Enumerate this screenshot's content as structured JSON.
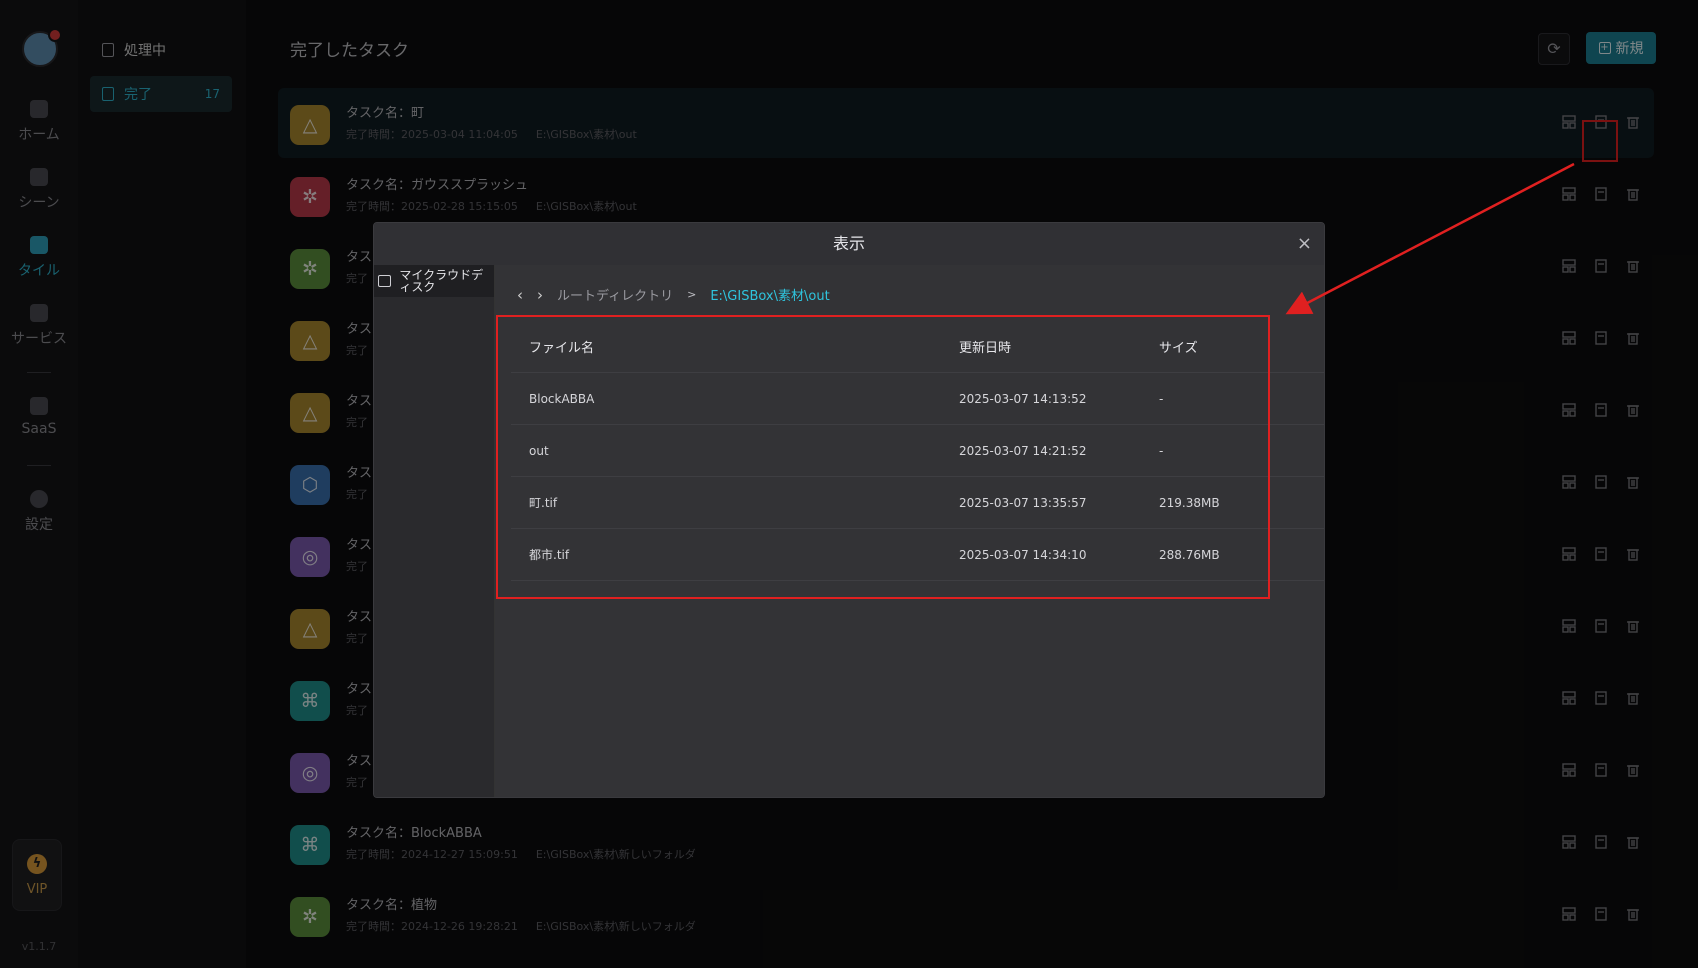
{
  "sidebar": {
    "items": [
      {
        "label": "ホーム"
      },
      {
        "label": "シーン"
      },
      {
        "label": "タイル"
      },
      {
        "label": "サービス"
      },
      {
        "label": "SaaS"
      },
      {
        "label": "設定"
      }
    ],
    "vip_label": "VIP",
    "version": "v1.1.7"
  },
  "subnav": {
    "processing_label": "処理中",
    "done_label": "完了",
    "done_count": "17"
  },
  "main": {
    "title": "完了したタスク",
    "new_label": "新規"
  },
  "tasks": [
    {
      "name": "タスク名：町",
      "time": "完了時間：2025-03-04 11:04:05",
      "path": "E:\\GISBox\\素材\\out",
      "color": "#a8872f",
      "glyph": "△"
    },
    {
      "name": "タスク名：ガウススプラッシュ",
      "time": "完了時間：2025-02-28 15:15:05",
      "path": "E:\\GISBox\\素材\\out",
      "color": "#b83a4a",
      "glyph": "✲"
    },
    {
      "name": "タス",
      "time": "完了",
      "path": "",
      "color": "#5c8f3c",
      "glyph": "✲"
    },
    {
      "name": "タス",
      "time": "完了",
      "path": "",
      "color": "#a8872f",
      "glyph": "△"
    },
    {
      "name": "タス",
      "time": "完了",
      "path": "",
      "color": "#a8872f",
      "glyph": "△"
    },
    {
      "name": "タス",
      "time": "完了",
      "path": "",
      "color": "#3a6fae",
      "glyph": "⬡"
    },
    {
      "name": "タス",
      "time": "完了",
      "path": "",
      "color": "#7a5aae",
      "glyph": "◎"
    },
    {
      "name": "タス",
      "time": "完了",
      "path": "",
      "color": "#a8872f",
      "glyph": "△"
    },
    {
      "name": "タス",
      "time": "完了",
      "path": "",
      "color": "#1f8f8a",
      "glyph": "⌘"
    },
    {
      "name": "タス",
      "time": "完了",
      "path": "",
      "color": "#7a5aae",
      "glyph": "◎"
    },
    {
      "name": "タスク名：BlockABBA",
      "time": "完了時間：2024-12-27 15:09:51",
      "path": "E:\\GISBox\\素材\\新しいフォルダ",
      "color": "#1f8f8a",
      "glyph": "⌘"
    },
    {
      "name": "タスク名：植物",
      "time": "完了時間：2024-12-26 19:28:21",
      "path": "E:\\GISBox\\素材\\新しいフォルダ",
      "color": "#5c8f3c",
      "glyph": "✲"
    }
  ],
  "dialog": {
    "title": "表示",
    "close": "×",
    "disk_label": "マイクラウドディスク",
    "crumb_root": "ルートディレクトリ",
    "crumb_sep": ">",
    "crumb_current": "E:\\GISBox\\素材\\out",
    "columns": [
      "ファイル名",
      "更新日時",
      "サイズ"
    ],
    "files": [
      {
        "name": "BlockABBA",
        "date": "2025-03-07 14:13:52",
        "size": "-"
      },
      {
        "name": "out",
        "date": "2025-03-07 14:21:52",
        "size": "-"
      },
      {
        "name": "町.tif",
        "date": "2025-03-07 13:35:57",
        "size": "219.38MB"
      },
      {
        "name": "都市.tif",
        "date": "2025-03-07 14:34:10",
        "size": "288.76MB"
      }
    ]
  },
  "colors": {
    "accent": "#2fb3cc",
    "highlight": "#e02020"
  }
}
